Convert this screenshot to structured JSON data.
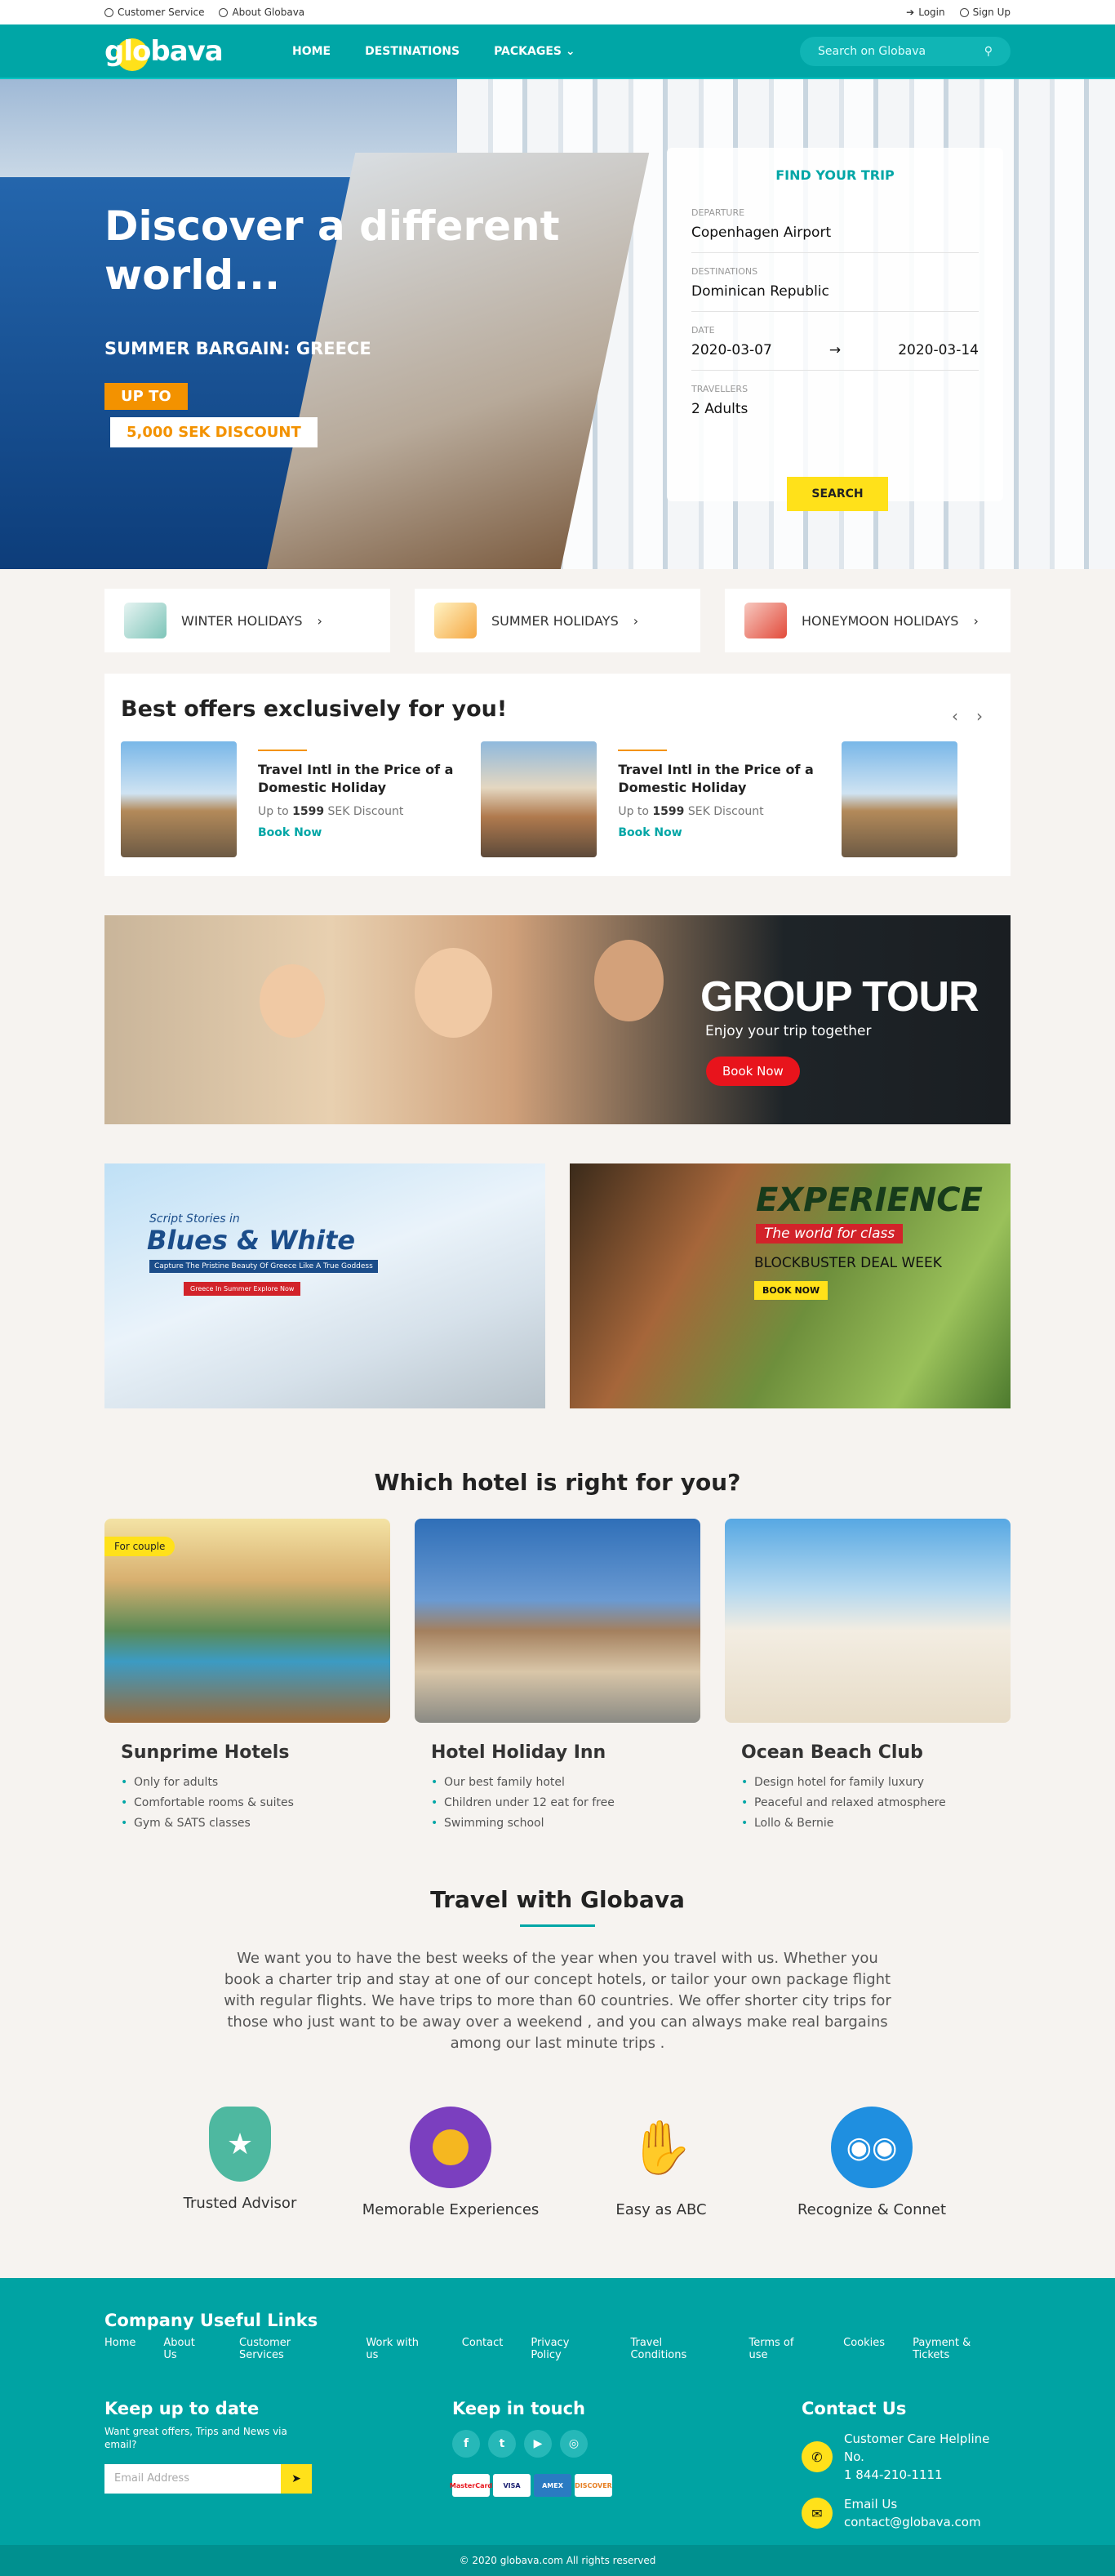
{
  "topbar": {
    "customer_service": "Customer Service",
    "about": "About Globava",
    "login": "Login",
    "signup": "Sign Up"
  },
  "nav": {
    "logo": "globava",
    "items": [
      "HOME",
      "DESTINATIONS",
      "PACKAGES"
    ],
    "search_placeholder": "Search on Globava"
  },
  "hero": {
    "heading": "Discover a different world...",
    "bargain": "SUMMER BARGAIN: GREECE",
    "upto": "UP TO",
    "discount": "5,000 SEK DISCOUNT"
  },
  "trip": {
    "title": "FIND YOUR TRIP",
    "departure_label": "DEPARTURE",
    "departure": "Copenhagen Airport",
    "destination_label": "DESTINATIONS",
    "destination": "Dominican Republic",
    "date_label": "DATE",
    "date_from": "2020-03-07",
    "date_to": "2020-03-14",
    "travellers_label": "TRAVELLERS",
    "travellers": "2 Adults",
    "search": "SEARCH"
  },
  "categories": [
    {
      "label": "WINTER HOLIDAYS"
    },
    {
      "label": "SUMMER HOLIDAYS"
    },
    {
      "label": "HONEYMOON HOLIDAYS"
    }
  ],
  "offers": {
    "title": "Best offers exclusively for you!",
    "items": [
      {
        "title": "Travel Intl in the Price of a Domestic Holiday",
        "pre": "Up to",
        "amount": "1599",
        "post": "SEK Discount",
        "cta": "Book Now"
      },
      {
        "title": "Travel Intl in the Price of a Domestic Holiday",
        "pre": "Up to",
        "amount": "1599",
        "post": "SEK Discount",
        "cta": "Book Now"
      }
    ]
  },
  "group": {
    "title": "GROUP TOUR",
    "subtitle": "Enjoy your trip together",
    "cta": "Book Now"
  },
  "promo1": {
    "line1": "Script Stories in",
    "line2": "Blues & White",
    "line3": "Capture The Pristine Beauty Of Greece Like A True Goddess",
    "line4": "Greece In Summer Explore Now"
  },
  "promo2": {
    "title": "EXPERIENCE",
    "tagline": "The world for class",
    "deal": "BLOCKBUSTER DEAL WEEK",
    "cta": "BOOK NOW"
  },
  "hotels": {
    "title": "Which hotel is right for you?",
    "items": [
      {
        "name": "Sunprime Hotels",
        "tag": "For couple",
        "features": [
          "Only for adults",
          "Comfortable rooms & suites",
          "Gym & SATS classes"
        ]
      },
      {
        "name": "Hotel Holiday Inn",
        "features": [
          "Our best family hotel",
          "Children under 12 eat for free",
          "Swimming school"
        ]
      },
      {
        "name": "Ocean Beach Club",
        "features": [
          "Design hotel for family luxury",
          "Peaceful and relaxed atmosphere",
          "Lollo & Bernie"
        ]
      }
    ]
  },
  "travel": {
    "title": "Travel with Globava",
    "text": "We want you to have the best weeks of the year when you travel with us. Whether you book a charter trip and stay at one of our concept hotels, or tailor your own package flight with regular flights. We have trips to more than 60 countries. We offer shorter city trips for those who just want to be away over a weekend , and you can always make real bargains among our last minute trips .",
    "features": [
      {
        "label": "Trusted Advisor",
        "icon": "shield-star-icon"
      },
      {
        "label": "Memorable Experiences",
        "icon": "medal-icon"
      },
      {
        "label": "Easy as ABC",
        "icon": "hand-icon"
      },
      {
        "label": "Recognize & Connet",
        "icon": "people-icon"
      }
    ]
  },
  "footer": {
    "links_title": "Company Useful Links",
    "links": [
      "Home",
      "About Us",
      "Customer Services",
      "Work with us",
      "Contact",
      "Privacy Policy",
      "Travel Conditions",
      "Terms of use",
      "Cookies",
      "Payment & Tickets"
    ],
    "keep_title": "Keep up to date",
    "keep_text": "Want great offers, Trips and News via email?",
    "email_placeholder": "Email Address",
    "touch_title": "Keep in touch",
    "contact_title": "Contact Us",
    "helpline_label": "Customer Care Helpline No.",
    "helpline": "1 844-210-1111",
    "email_label": "Email Us",
    "email": "contact@globava.com",
    "cards": [
      "MasterCard",
      "VISA",
      "AMEX",
      "DISCOVER"
    ],
    "copyright": "© 2020 globava.com All rights reserved"
  },
  "colors": {
    "teal": "#00a6a6",
    "yellow": "#ffe11a",
    "orange": "#f39200",
    "red": "#e8141c"
  }
}
